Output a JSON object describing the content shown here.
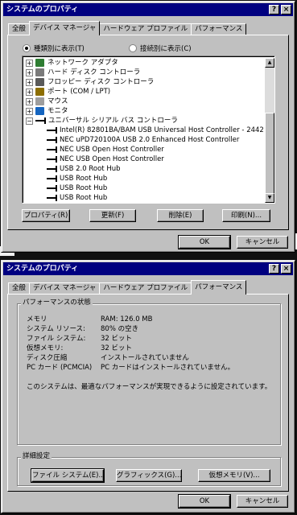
{
  "window1": {
    "title": "システムのプロパティ",
    "title_buttons": [
      "?",
      "×"
    ],
    "tabs": [
      "全般",
      "デバイス マネージャ",
      "ハードウェア プロファイル",
      "パフォーマンス"
    ],
    "radio_type": "種類別に表示(T)",
    "radio_connection": "接続別に表示(C)",
    "tree": [
      {
        "label": "ネットワーク アダプタ",
        "icon": "network-adapter-icon",
        "exp": "+"
      },
      {
        "label": "ハード ディスク コントローラ",
        "icon": "hard-disk-controller-icon",
        "exp": "+"
      },
      {
        "label": "フロッピー ディスク コントローラ",
        "icon": "floppy-controller-icon",
        "exp": "+"
      },
      {
        "label": "ポート (COM / LPT)",
        "icon": "port-icon",
        "exp": "+"
      },
      {
        "label": "マウス",
        "icon": "mouse-icon",
        "exp": "+"
      },
      {
        "label": "モニタ",
        "icon": "monitor-icon",
        "exp": "+"
      },
      {
        "label": "ユニバーサル シリアル バス コントローラ",
        "icon": "usb-icon",
        "exp": "−"
      },
      {
        "label": "Intel(R) 82801BA/BAM USB Universal Host Controller - 2442",
        "icon": "usb-icon"
      },
      {
        "label": "NEC uPD720100A USB 2.0 Enhanced Host Controller",
        "icon": "usb-icon"
      },
      {
        "label": "NEC USB Open Host Controller",
        "icon": "usb-icon"
      },
      {
        "label": "NEC USB Open Host Controller",
        "icon": "usb-icon"
      },
      {
        "label": "USB 2.0 Root Hub",
        "icon": "usb-icon"
      },
      {
        "label": "USB Root Hub",
        "icon": "usb-icon"
      },
      {
        "label": "USB Root Hub",
        "icon": "usb-icon"
      },
      {
        "label": "USB Root Hub",
        "icon": "usb-icon"
      }
    ],
    "buttons": [
      "プロパティ(R)",
      "更新(F)",
      "削除(E)",
      "印刷(N)..."
    ],
    "ok": "OK",
    "cancel": "キャンセル"
  },
  "window2": {
    "title": "システムのプロパティ",
    "title_buttons": [
      "?",
      "×"
    ],
    "tabs": [
      "全般",
      "デバイス マネージャ",
      "ハードウェア プロファイル",
      "パフォーマンス"
    ],
    "group_status": "パフォーマンスの状態",
    "rows": [
      {
        "label": "メモリ",
        "value": "RAM: 126.0 MB"
      },
      {
        "label": "システム リソース:",
        "value": "80% の空き"
      },
      {
        "label": "ファイル システム:",
        "value": "32 ビット"
      },
      {
        "label": "仮想メモリ:",
        "value": "32 ビット"
      },
      {
        "label": "ディスク圧縮",
        "value": "インストールされていません"
      },
      {
        "label": "PC カード (PCMCIA)",
        "value": "PC カードはインストールされていません。"
      }
    ],
    "message": "このシステムは、最適なパフォーマンスが実現できるように設定されています。",
    "group_advanced": "詳細設定",
    "buttons": [
      "ファイル システム(E)...",
      "グラフィックス(G)...",
      "仮想メモリ(V)..."
    ],
    "ok": "OK",
    "cancel": "キャンセル"
  },
  "colors": {
    "titlebar": "#000080",
    "face": "#c0c0c0",
    "desktop": "#1a1a1a"
  }
}
